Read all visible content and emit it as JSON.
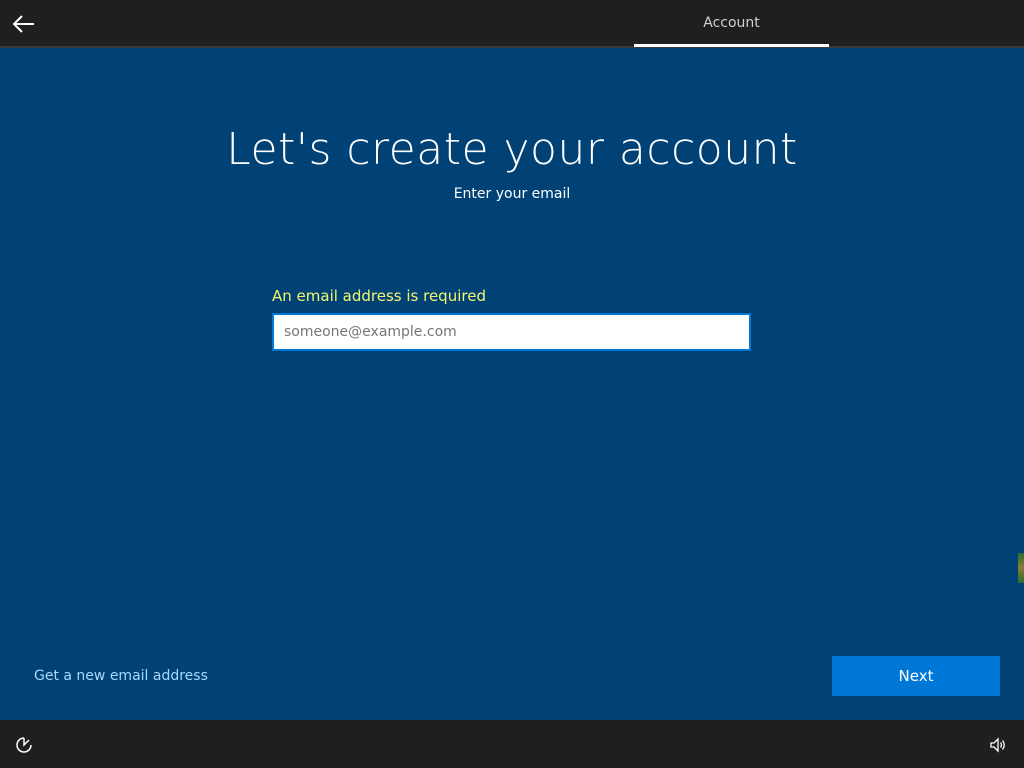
{
  "header": {
    "back_icon": "arrow-left-icon",
    "active_tab": "Account"
  },
  "main": {
    "title": "Let's create your account",
    "subtitle": "Enter your email",
    "error_message": "An email address is required",
    "email_input": {
      "value": "",
      "placeholder": "someone@example.com"
    },
    "new_email_link": "Get a new email address",
    "next_button": "Next"
  },
  "footer": {
    "ease_of_access_icon": "ease-of-access-icon",
    "volume_icon": "volume-icon"
  },
  "colors": {
    "background": "#004275",
    "bar": "#1f1f1f",
    "accent": "#0078d7",
    "error": "#f5f56e",
    "link": "#a6d8ff"
  }
}
